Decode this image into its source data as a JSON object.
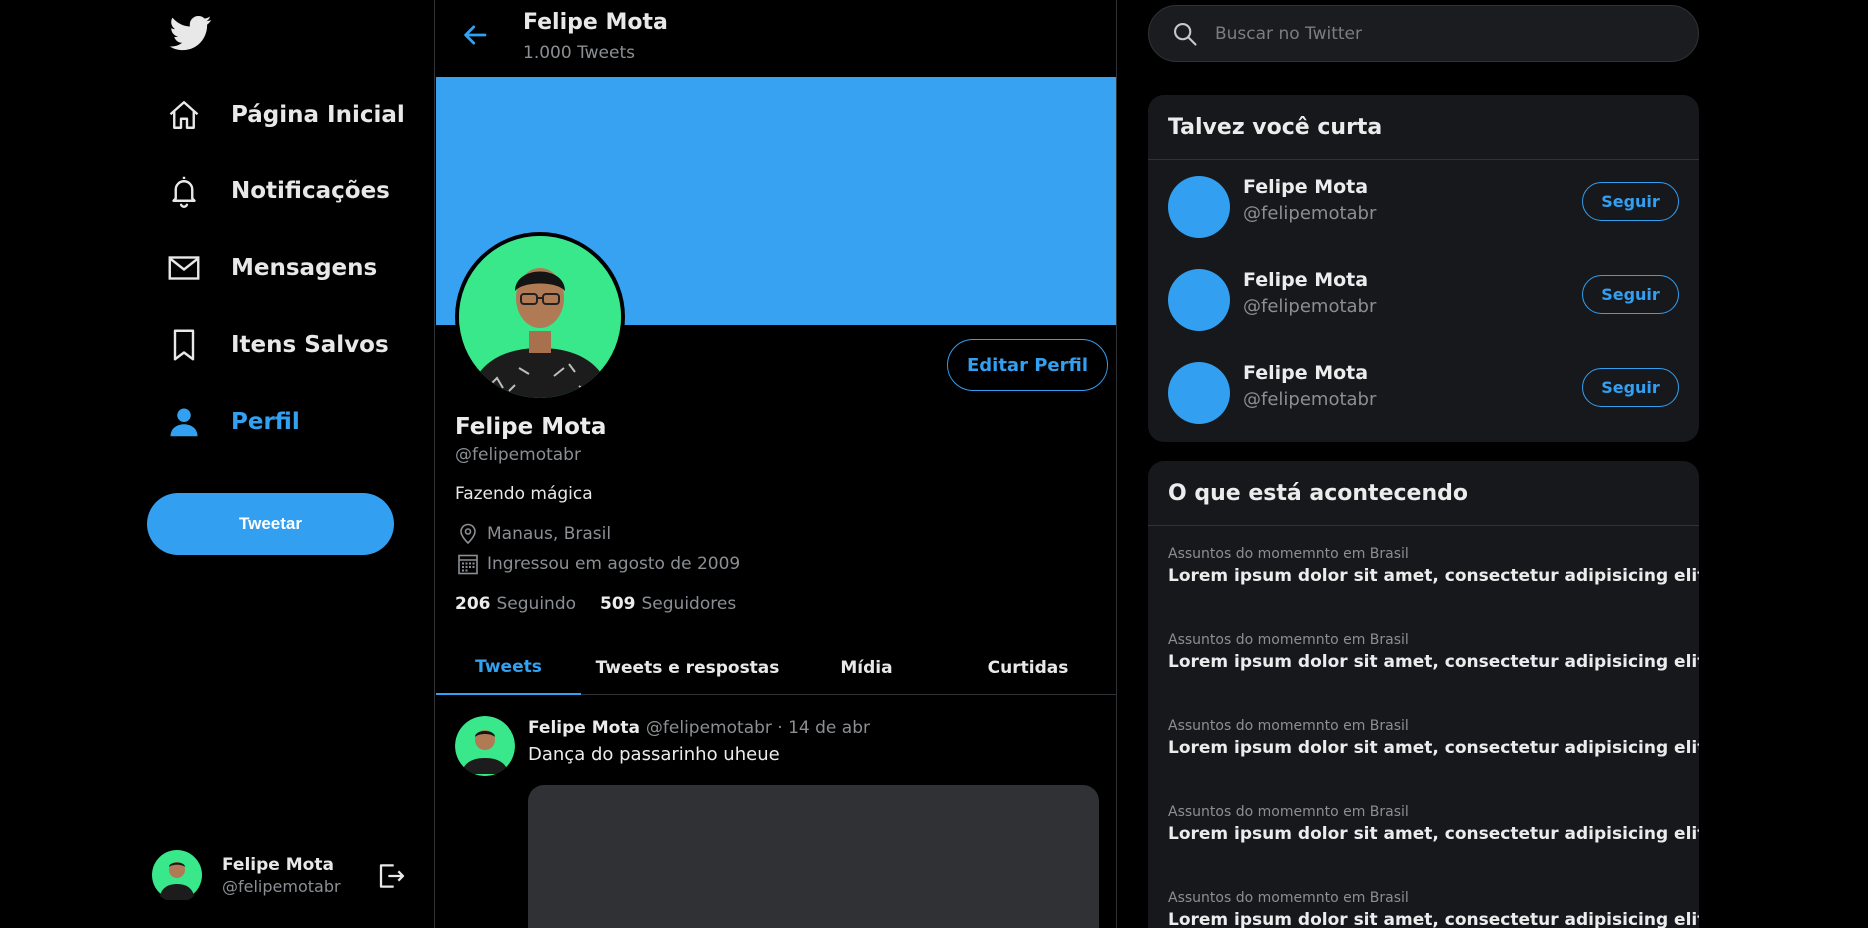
{
  "sidebar": {
    "logo_icon": "twitter-bird-icon",
    "items": [
      {
        "label": "Página Inicial",
        "icon": "home-icon",
        "active": false
      },
      {
        "label": "Notificações",
        "icon": "bell-icon",
        "active": false
      },
      {
        "label": "Mensagens",
        "icon": "mail-icon",
        "active": false
      },
      {
        "label": "Itens Salvos",
        "icon": "bookmark-icon",
        "active": false
      },
      {
        "label": "Perfil",
        "icon": "person-icon",
        "active": true
      }
    ],
    "tweet_button": "Tweetar",
    "account": {
      "name": "Felipe Mota",
      "handle": "@felipemotabr",
      "logout_icon": "logout-icon"
    }
  },
  "header": {
    "name": "Felipe Mota",
    "tweet_count": "1.000 Tweets",
    "back_icon": "arrow-left-icon"
  },
  "profile": {
    "name": "Felipe Mota",
    "handle": "@felipemotabr",
    "bio": "Fazendo mágica",
    "location": "Manaus, Brasil",
    "joined": "Ingressou em agosto de 2009",
    "following_count": "206",
    "following_label": "Seguindo",
    "followers_count": "509",
    "followers_label": "Seguidores",
    "edit_button": "Editar Perfil",
    "banner_color": "#36a2f1",
    "avatar_bg": "#38e88a"
  },
  "tabs": [
    {
      "label": "Tweets",
      "active": true
    },
    {
      "label": "Tweets e respostas",
      "active": false
    },
    {
      "label": "Mídia",
      "active": false
    },
    {
      "label": "Curtidas",
      "active": false
    }
  ],
  "tweet": {
    "name": "Felipe Mota",
    "handle": "@felipemotabr",
    "date": "· 14 de abr",
    "text": "Dança do passarinho uheue"
  },
  "search": {
    "placeholder": "Buscar no Twitter",
    "icon": "search-icon"
  },
  "who_to_follow": {
    "title": "Talvez você curta",
    "users": [
      {
        "name": "Felipe Mota",
        "handle": "@felipemotabr",
        "button": "Seguir"
      },
      {
        "name": "Felipe Mota",
        "handle": "@felipemotabr",
        "button": "Seguir"
      },
      {
        "name": "Felipe Mota",
        "handle": "@felipemotabr",
        "button": "Seguir"
      }
    ]
  },
  "trends": {
    "title": "O que está acontecendo",
    "items": [
      {
        "context": "Assuntos do momemnto em Brasil",
        "title": "Lorem ipsum dolor sit amet, consectetur adipisicing elit"
      },
      {
        "context": "Assuntos do momemnto em Brasil",
        "title": "Lorem ipsum dolor sit amet, consectetur adipisicing elit"
      },
      {
        "context": "Assuntos do momemnto em Brasil",
        "title": "Lorem ipsum dolor sit amet, consectetur adipisicing elit"
      },
      {
        "context": "Assuntos do momemnto em Brasil",
        "title": "Lorem ipsum dolor sit amet, consectetur adipisicing elit"
      },
      {
        "context": "Assuntos do momemnto em Brasil",
        "title": "Lorem ipsum dolor sit amet, consectetur adipisicing elit"
      }
    ]
  },
  "colors": {
    "accent": "#339ff0",
    "background": "#000000",
    "card": "#16181c",
    "muted": "#8b8f93"
  }
}
